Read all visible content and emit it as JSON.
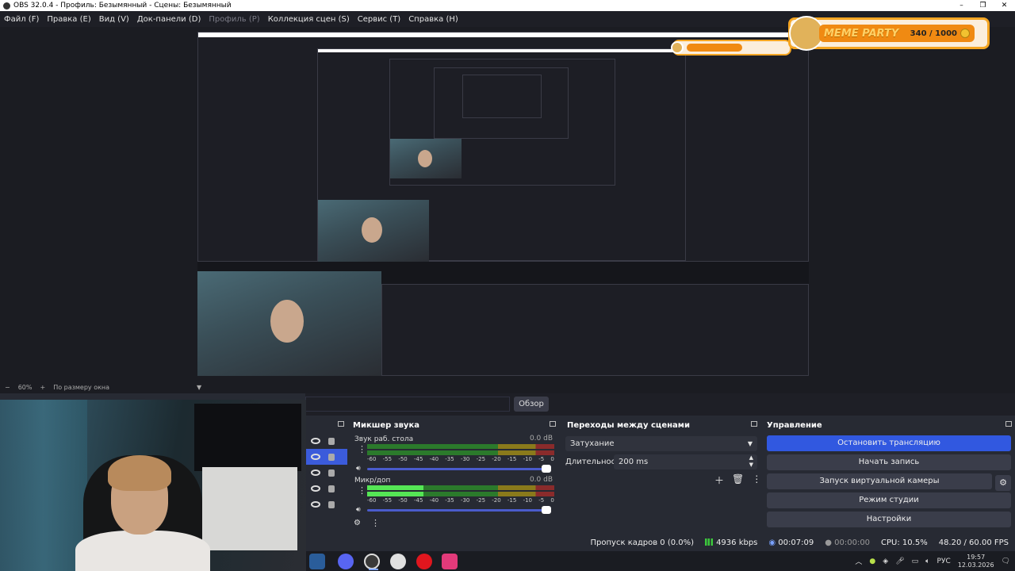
{
  "window": {
    "title": "OBS 32.0.4 - Профиль: Безымянный - Сцены: Безымянный",
    "min": "–",
    "max": "❐",
    "close": "✕"
  },
  "menu": [
    {
      "label": "Файл (F)",
      "disabled": false
    },
    {
      "label": "Правка (E)",
      "disabled": false
    },
    {
      "label": "Вид (V)",
      "disabled": false
    },
    {
      "label": "Док-панели (D)",
      "disabled": false
    },
    {
      "label": "Профиль (P)",
      "disabled": true
    },
    {
      "label": "Коллекция сцен (S)",
      "disabled": false
    },
    {
      "label": "Сервис (T)",
      "disabled": false
    },
    {
      "label": "Справка (H)",
      "disabled": false
    }
  ],
  "meme_widget": {
    "title": "MEME PARTY",
    "score": "340 / 1000",
    "progress": 0.34
  },
  "zoom": {
    "minus": "−",
    "value": "60%",
    "plus": "+",
    "mode": "По размеру окна",
    "caret": "▼"
  },
  "browse": {
    "label": "Обзор"
  },
  "mixer": {
    "title": "Микшер звука",
    "scale": [
      "-60",
      "-55",
      "-50",
      "-45",
      "-40",
      "-35",
      "-30",
      "-25",
      "-20",
      "-15",
      "-10",
      "-5",
      "0"
    ],
    "tracks": [
      {
        "name": "Звук раб. стола",
        "db": "0.0 dB",
        "level": 0.0
      },
      {
        "name": "Микр/доп",
        "db": "0.0 dB",
        "level": 0.3
      }
    ]
  },
  "transitions": {
    "title": "Переходы между сценами",
    "selected": "Затухание",
    "duration_label": "Длительность",
    "duration_value": "200 ms"
  },
  "controls": {
    "title": "Управление",
    "buttons": [
      "Остановить трансляцию",
      "Начать запись",
      "Запуск виртуальной камеры",
      "Режим студии",
      "Настройки"
    ]
  },
  "status": {
    "dropped": "Пропуск кадров 0 (0.0%)",
    "bitrate": "4936 kbps",
    "stream_time": "00:07:09",
    "rec_time": "00:00:00",
    "cpu": "CPU: 10.5%",
    "fps": "48.20 / 60.00 FPS"
  },
  "taskbar": {
    "lang": "РУС",
    "time": "19:57",
    "date": "12.03.2026",
    "apps": [
      "steam-icon",
      "discord-icon",
      "obs-icon",
      "yandex-icon",
      "opera-icon",
      "app-icon"
    ]
  },
  "colors": {
    "accent": "#3158e0",
    "panel": "#272a33",
    "bg": "#1e1f26",
    "meter_green": "#55e655"
  }
}
